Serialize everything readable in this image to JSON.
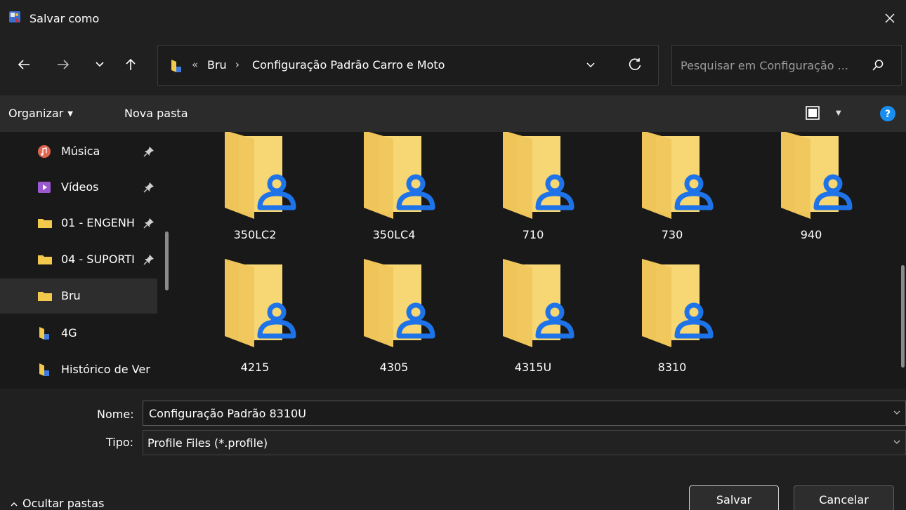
{
  "window": {
    "title": "Salvar como"
  },
  "address": {
    "separator": "«",
    "crumbs": [
      "Bru",
      "Configuração Padrão Carro e Moto"
    ],
    "arrow": "›"
  },
  "search": {
    "placeholder": "Pesquisar em Configuração ..."
  },
  "toolbar": {
    "organize_label": "Organizar",
    "new_folder_label": "Nova pasta"
  },
  "sidebar": {
    "items": [
      {
        "label": "Música",
        "icon": "music-icon",
        "pinned": true
      },
      {
        "label": "Vídeos",
        "icon": "videos-icon",
        "pinned": true
      },
      {
        "label": "01 - ENGENH",
        "icon": "folder-icon",
        "pinned": true
      },
      {
        "label": "04 - SUPORTI",
        "icon": "folder-icon",
        "pinned": true
      },
      {
        "label": "Bru",
        "icon": "folder-icon",
        "pinned": false,
        "selected": true
      },
      {
        "label": "4G",
        "icon": "shared-folder-icon",
        "pinned": false
      },
      {
        "label": "Histórico de Ver",
        "icon": "shared-folder-icon",
        "pinned": false
      }
    ]
  },
  "files": [
    {
      "name": "350LC2"
    },
    {
      "name": "350LC4"
    },
    {
      "name": "710"
    },
    {
      "name": "730"
    },
    {
      "name": "940"
    },
    {
      "name": "4215"
    },
    {
      "name": "4305"
    },
    {
      "name": "4315U"
    },
    {
      "name": "8310"
    }
  ],
  "form": {
    "name_label": "Nome:",
    "name_value": "Configuração Padrão 8310U",
    "type_label": "Tipo:",
    "type_value": "Profile Files (*.profile)"
  },
  "footer": {
    "hide_folders_label": "Ocultar pastas",
    "save_label": "Salvar",
    "cancel_label": "Cancelar"
  },
  "colors": {
    "background": "#202020",
    "pane": "#191919",
    "folder": "#f7d774",
    "user_badge": "#1e73e8",
    "help": "#1a8ef0"
  }
}
